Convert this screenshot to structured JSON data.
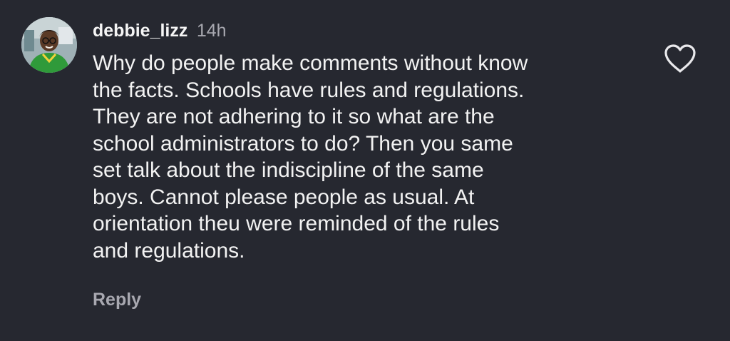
{
  "comment": {
    "username": "debbie_lizz",
    "time": "14h",
    "lines": [
      "Why do people make comments without know",
      "the facts. Schools have rules and regulations.",
      "They are not adhering to it so what are the",
      "school administrators to do? Then you same",
      "set talk about the indiscipline of the same",
      "boys. Cannot please people as usual. At",
      "orientation theu were reminded of the rules",
      "and regulations."
    ],
    "reply_label": "Reply",
    "like_icon": "heart-outline-icon"
  },
  "colors": {
    "background": "#262830",
    "text": "#f2f2f2",
    "muted": "#a8a8b0",
    "avatar_shirt": "#2f9a3a"
  }
}
